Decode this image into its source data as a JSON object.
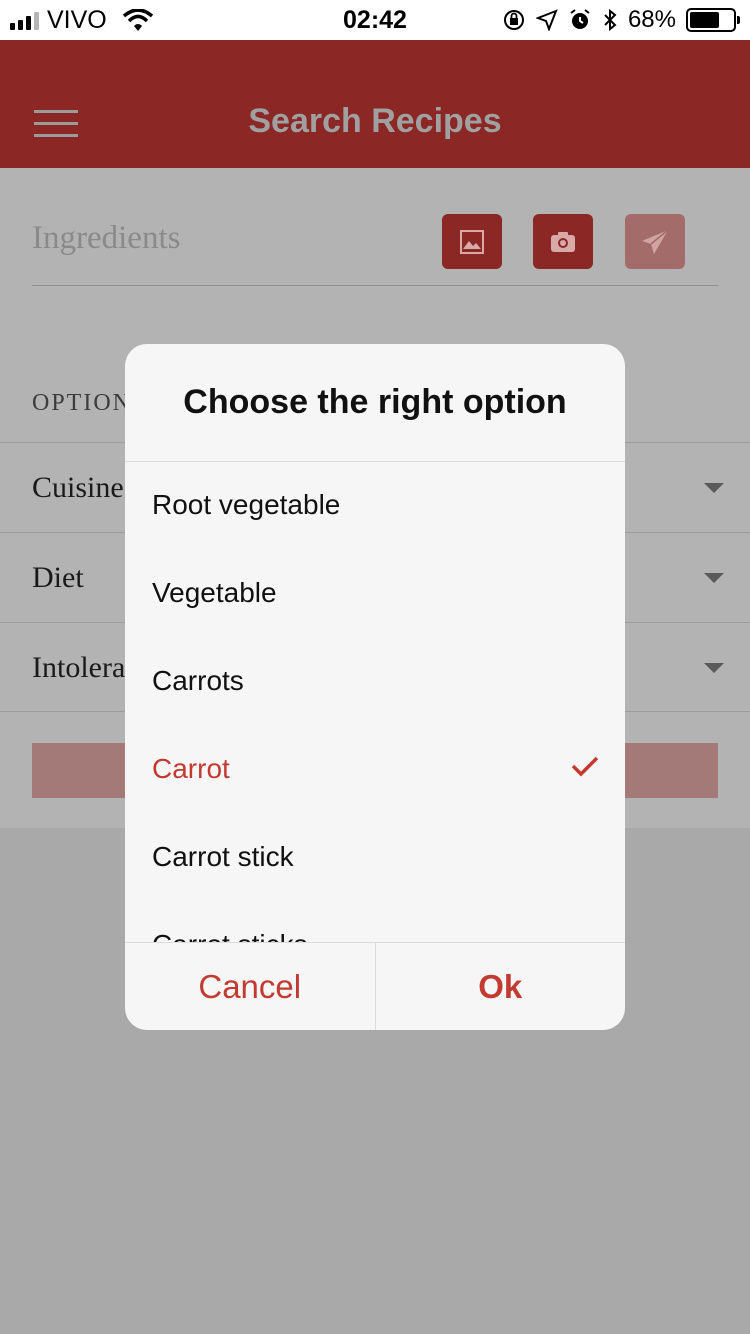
{
  "status_bar": {
    "carrier": "VIVO",
    "time": "02:42",
    "battery": "68%",
    "battery_level": 0.68
  },
  "header": {
    "title": "Search Recipes",
    "menu_icon": "hamburger-menu-icon"
  },
  "search": {
    "placeholder": "Ingredients",
    "buttons": [
      "image-icon",
      "camera-icon",
      "send-icon"
    ]
  },
  "options": {
    "section_label": "OPTIONS",
    "rows": [
      "Cuisine",
      "Diet",
      "Intolerances"
    ]
  },
  "dialog": {
    "title": "Choose the right option",
    "items": [
      "Root vegetable",
      "Vegetable",
      "Carrots",
      "Carrot",
      "Carrot stick",
      "Carrot sticks"
    ],
    "selected": "Carrot",
    "cancel_label": "Cancel",
    "ok_label": "Ok"
  },
  "colors": {
    "header_bg": "#8b2724",
    "accent": "#c33a31",
    "overlay": "#b3b3b3"
  }
}
